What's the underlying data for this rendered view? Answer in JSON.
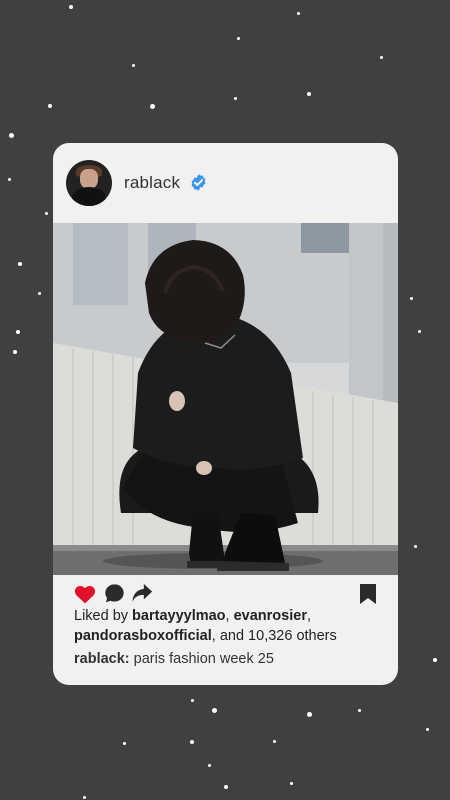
{
  "post": {
    "username": "rablack",
    "verified": true,
    "likes": {
      "prefix": "Liked by",
      "user1": "bartayyylmao",
      "sep1": ",",
      "user2": "evanrosier",
      "sep2": ",",
      "user3": "pandorasboxofficial",
      "suffix": ", and 10,326 others"
    },
    "caption": {
      "user": "rablack:",
      "text": "paris fashion week 25"
    },
    "liked": true
  },
  "colors": {
    "background": "#404040",
    "card": "#f1f1f1",
    "like": "#e0112b",
    "verified": "#3d95e6",
    "icon": "#2a2a2a"
  },
  "icons": {
    "like": "heart-icon",
    "comment": "comment-icon",
    "share": "share-icon",
    "save": "bookmark-icon",
    "verified": "verified-badge-icon"
  }
}
